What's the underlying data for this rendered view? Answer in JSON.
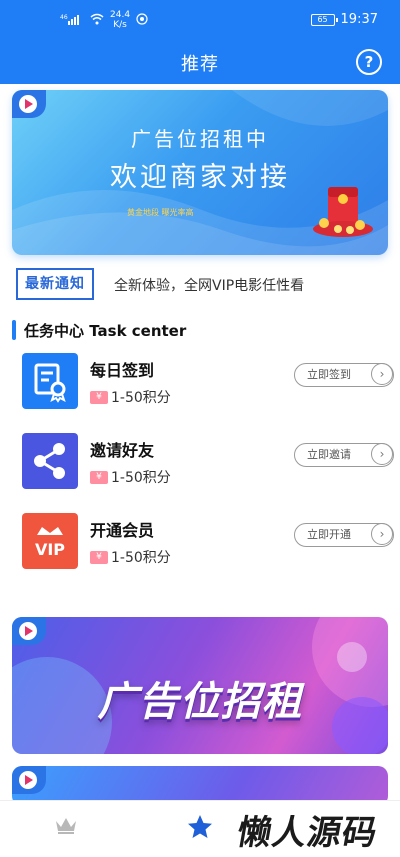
{
  "status_bar": {
    "signal": "⁴⁶",
    "speed_value": "24.4",
    "speed_unit": "K/s",
    "battery": "65",
    "time": "19:37"
  },
  "header": {
    "title": "推荐",
    "help_label": "?"
  },
  "banner1": {
    "title": "广告位招租中",
    "subtitle": "欢迎商家对接",
    "tagline": "黄金地段 曝光率高"
  },
  "notice": {
    "badge": "最新通知",
    "text": "全新体验，全网VIP电影任性看"
  },
  "task_center": {
    "title": "任务中心 Task center",
    "tasks": [
      {
        "name": "每日签到",
        "points": "1-50积分",
        "button": "立即签到",
        "icon": "certificate-icon",
        "color": "#1f7ef6"
      },
      {
        "name": "邀请好友",
        "points": "1-50积分",
        "button": "立即邀请",
        "icon": "share-icon",
        "color": "#4a55e0"
      },
      {
        "name": "开通会员",
        "points": "1-50积分",
        "button": "立即开通",
        "icon": "vip-crown-icon",
        "color": "#f0553e"
      }
    ]
  },
  "banner2": {
    "title": "广告位招租"
  },
  "watermark": "懒人源码",
  "colors": {
    "primary": "#1f7ef6",
    "ticket": "#ff8fa0"
  }
}
